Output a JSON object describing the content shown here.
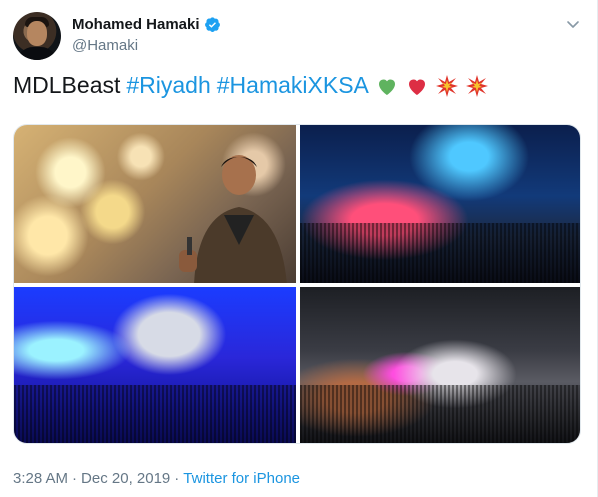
{
  "tweet": {
    "author_name": "Mohamed Hamaki",
    "author_handle": "@Hamaki",
    "text_plain": "MDLBeast",
    "hashtags": [
      "#Riyadh",
      "#HamakiXKSA"
    ],
    "emojis": [
      "green-heart",
      "red-heart",
      "sparkle-burst",
      "sparkle-burst"
    ],
    "time": "3:28 AM",
    "separator": "·",
    "date": "Dec 20, 2019",
    "source": "Twitter for iPhone"
  },
  "colors": {
    "link": "#1b95e0",
    "verified": "#1da1f2",
    "muted": "#657786"
  },
  "media": {
    "photos": [
      "concert-photo-singer",
      "concert-photo-stage-red-blue",
      "concert-photo-stage-blue",
      "concert-photo-stage-smoke"
    ]
  }
}
